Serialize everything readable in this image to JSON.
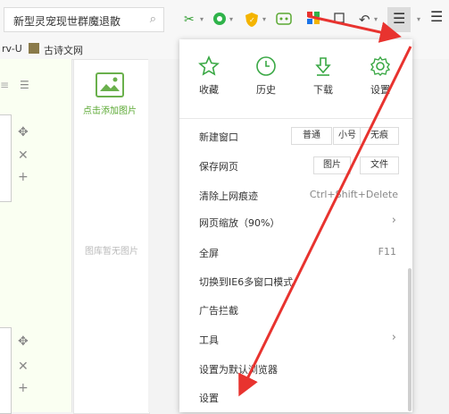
{
  "toolbar": {
    "address_text": "新型灵宠现世群魔退散",
    "right_menu_glyph": "☰"
  },
  "bookmarks": [
    {
      "label": "rv-U"
    },
    {
      "label": "古诗文网"
    }
  ],
  "left_panel": {
    "add_image_label": "点击添加图片",
    "no_image_label": "图库暂无图片"
  },
  "menu": {
    "top_icons": [
      {
        "label": "收藏",
        "icon": "star-icon"
      },
      {
        "label": "历史",
        "icon": "clock-icon"
      },
      {
        "label": "下载",
        "icon": "download-icon"
      },
      {
        "label": "设置",
        "icon": "gear-icon"
      }
    ],
    "new_window": {
      "label": "新建窗口",
      "opt1": "普通",
      "opt2": "小号",
      "opt3": "无痕"
    },
    "save_page": {
      "label": "保存网页",
      "opt1": "图片",
      "opt2": "文件"
    },
    "clear_history": {
      "label": "清除上网痕迹",
      "shortcut": "Ctrl+Shift+Delete"
    },
    "zoom": {
      "label": "网页缩放（90%）"
    },
    "fullscreen": {
      "label": "全屏",
      "shortcut": "F11"
    },
    "ie6": {
      "label": "切换到IE6多窗口模式"
    },
    "adblock": {
      "label": "广告拦截"
    },
    "tools": {
      "label": "工具"
    },
    "default_browser": {
      "label": "设置为默认浏览器"
    },
    "settings": {
      "label": "设置"
    }
  },
  "colors": {
    "accent_green": "#5aa832",
    "arrow_red": "#e8332f"
  }
}
